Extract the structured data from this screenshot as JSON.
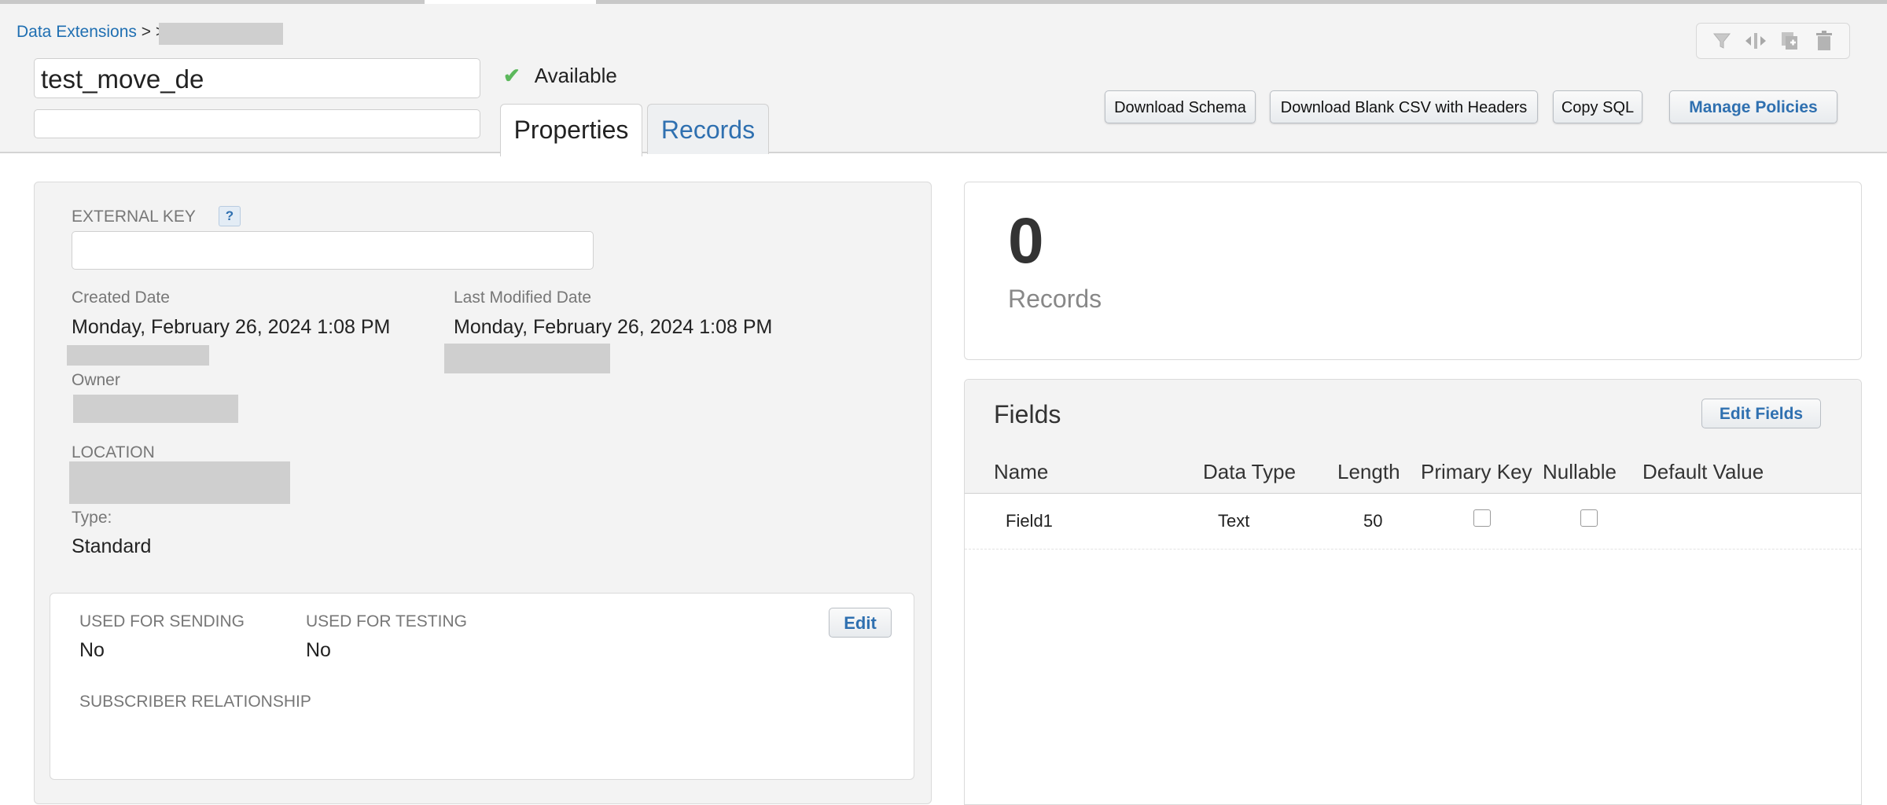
{
  "breadcrumb": {
    "root": "Data Extensions",
    "sep1": ">",
    "sep2": ">",
    "current": "test_move_de"
  },
  "header": {
    "name_value": "test_move_de",
    "status": "Available",
    "tabs": [
      {
        "label": "Properties"
      },
      {
        "label": "Records"
      }
    ],
    "buttons": {
      "download_schema": "Download Schema",
      "download_csv": "Download Blank CSV with Headers",
      "copy_sql": "Copy SQL",
      "manage_policies": "Manage Policies"
    },
    "toolbar_icons": [
      "filter-icon",
      "move-icon",
      "copy-add-icon",
      "trash-icon"
    ]
  },
  "properties": {
    "external_key_label": "EXTERNAL KEY",
    "help_label": "?",
    "created_label": "Created Date",
    "created_value": "Monday, February 26, 2024 1:08 PM",
    "modified_label": "Last Modified Date",
    "modified_value": "Monday, February 26, 2024 1:08 PM",
    "owner_label": "Owner",
    "location_label": "LOCATION",
    "type_label": "Type:",
    "type_value": "Standard",
    "sending_label": "USED FOR SENDING",
    "sending_value": "No",
    "testing_label": "USED FOR TESTING",
    "testing_value": "No",
    "subscriber_label": "SUBSCRIBER RELATIONSHIP",
    "edit_label": "Edit"
  },
  "records": {
    "count": "0",
    "label": "Records"
  },
  "fields": {
    "title": "Fields",
    "edit_label": "Edit Fields",
    "columns": [
      "Name",
      "Data Type",
      "Length",
      "Primary Key",
      "Nullable",
      "Default Value"
    ],
    "rows": [
      {
        "name": "Field1",
        "type": "Text",
        "length": "50",
        "primary_key": false,
        "nullable": false
      }
    ]
  },
  "colors": {
    "accent": "#2f70b0",
    "success": "#5cb85c"
  }
}
